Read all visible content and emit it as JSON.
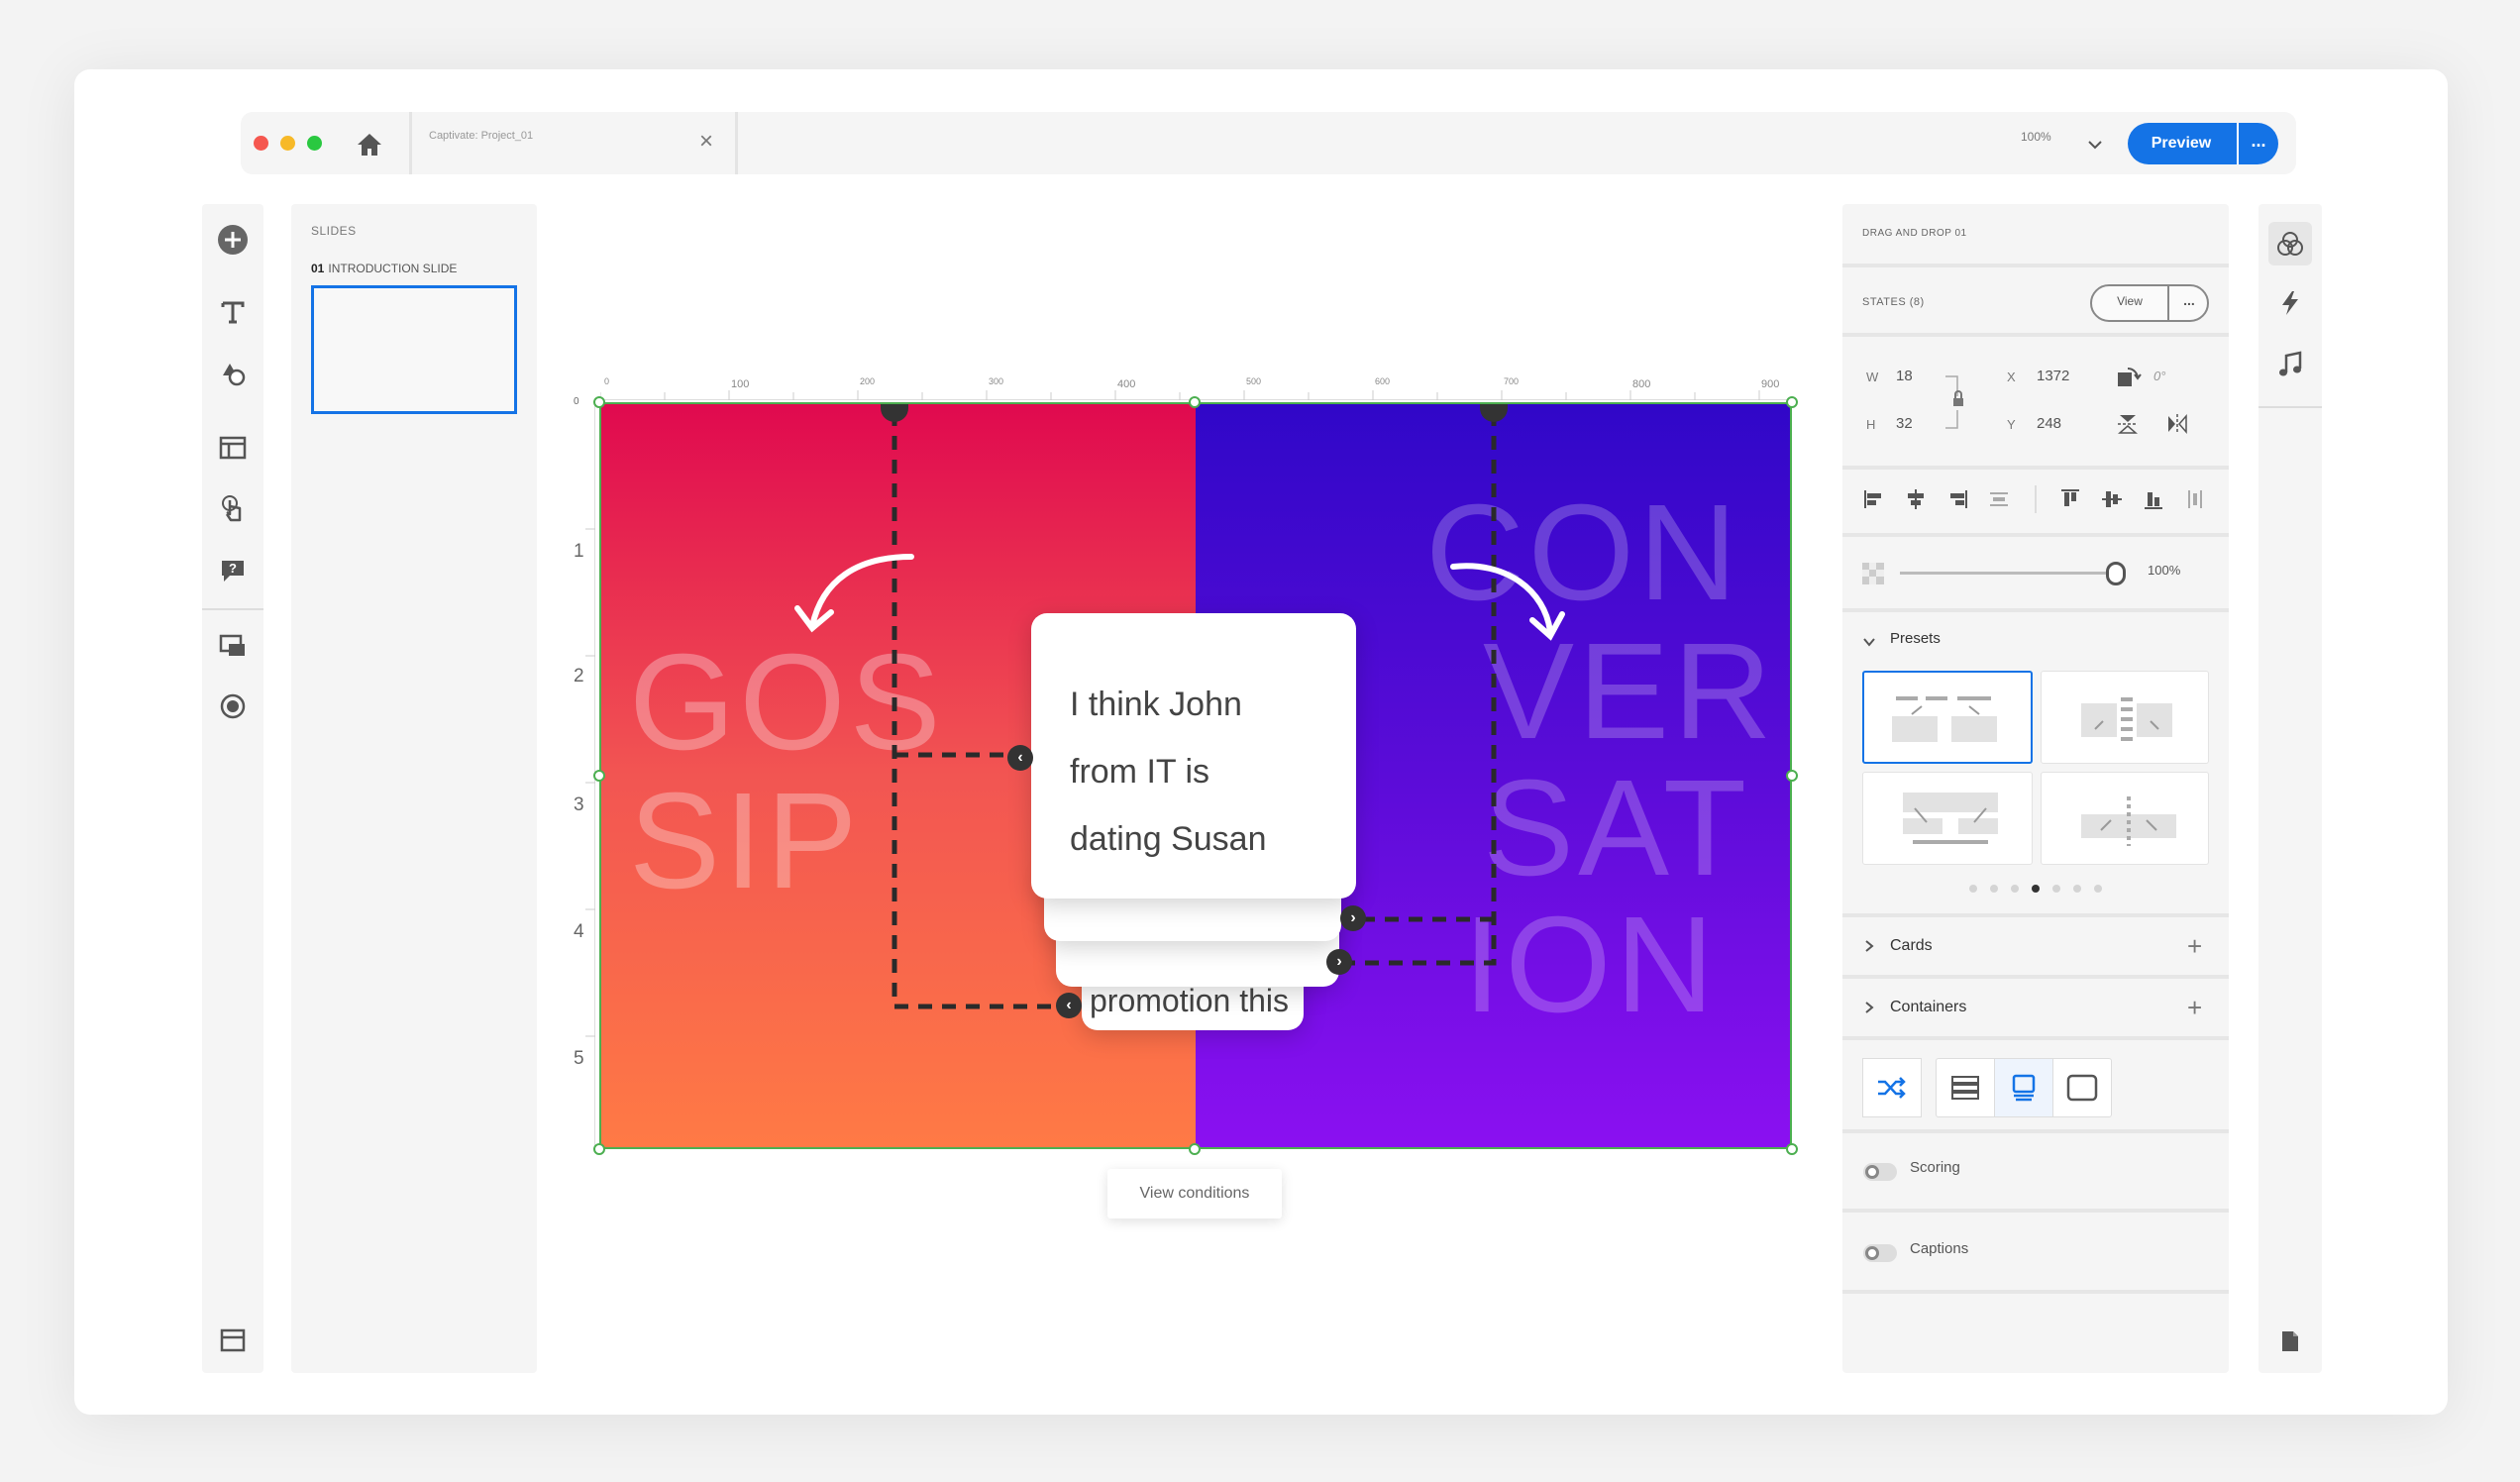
{
  "window": {
    "tab_title": "Captivate: Project_01",
    "zoom": "100%",
    "preview_label": "Preview",
    "more_label": "..."
  },
  "slides_panel": {
    "heading": "SLIDES",
    "slides": [
      {
        "number": "01",
        "title": "INTRODUCTION SLIDE"
      }
    ]
  },
  "ruler": {
    "top_ticks": [
      "0",
      "100",
      "200",
      "300",
      "400",
      "500",
      "600",
      "700",
      "800",
      "900"
    ],
    "left_ticks": [
      "0",
      "1",
      "2",
      "3",
      "4",
      "5"
    ]
  },
  "canvas": {
    "left_word_lines": [
      "GOS",
      "SIP"
    ],
    "right_word_lines": [
      "CON",
      "VER",
      "SAT",
      "ION"
    ],
    "card_lines": [
      "I think John",
      "from IT is",
      "dating Susan"
    ],
    "back_card_text": "promotion this",
    "view_conditions_label": "View conditions",
    "colors": {
      "left_gradient": [
        "#e0094f",
        "#ff7a45"
      ],
      "right_gradient": [
        "#3007c8",
        "#8b10f1"
      ],
      "selection": "#4caf50"
    }
  },
  "properties": {
    "object_name": "DRAG AND DROP 01",
    "states_label": "STATES (8)",
    "view_label": "View",
    "more_label": "...",
    "w_label": "W",
    "w_value": "18",
    "h_label": "H",
    "h_value": "32",
    "x_label": "X",
    "x_value": "1372",
    "y_label": "Y",
    "y_value": "248",
    "rotation": "0°",
    "opacity": "100%",
    "opacity_fraction": 1.0,
    "presets_label": "Presets",
    "preset_page_count": 7,
    "preset_page_active": 4,
    "cards_label": "Cards",
    "containers_label": "Containers",
    "scoring_label": "Scoring",
    "captions_label": "Captions"
  },
  "accent_color": "#1473e6"
}
